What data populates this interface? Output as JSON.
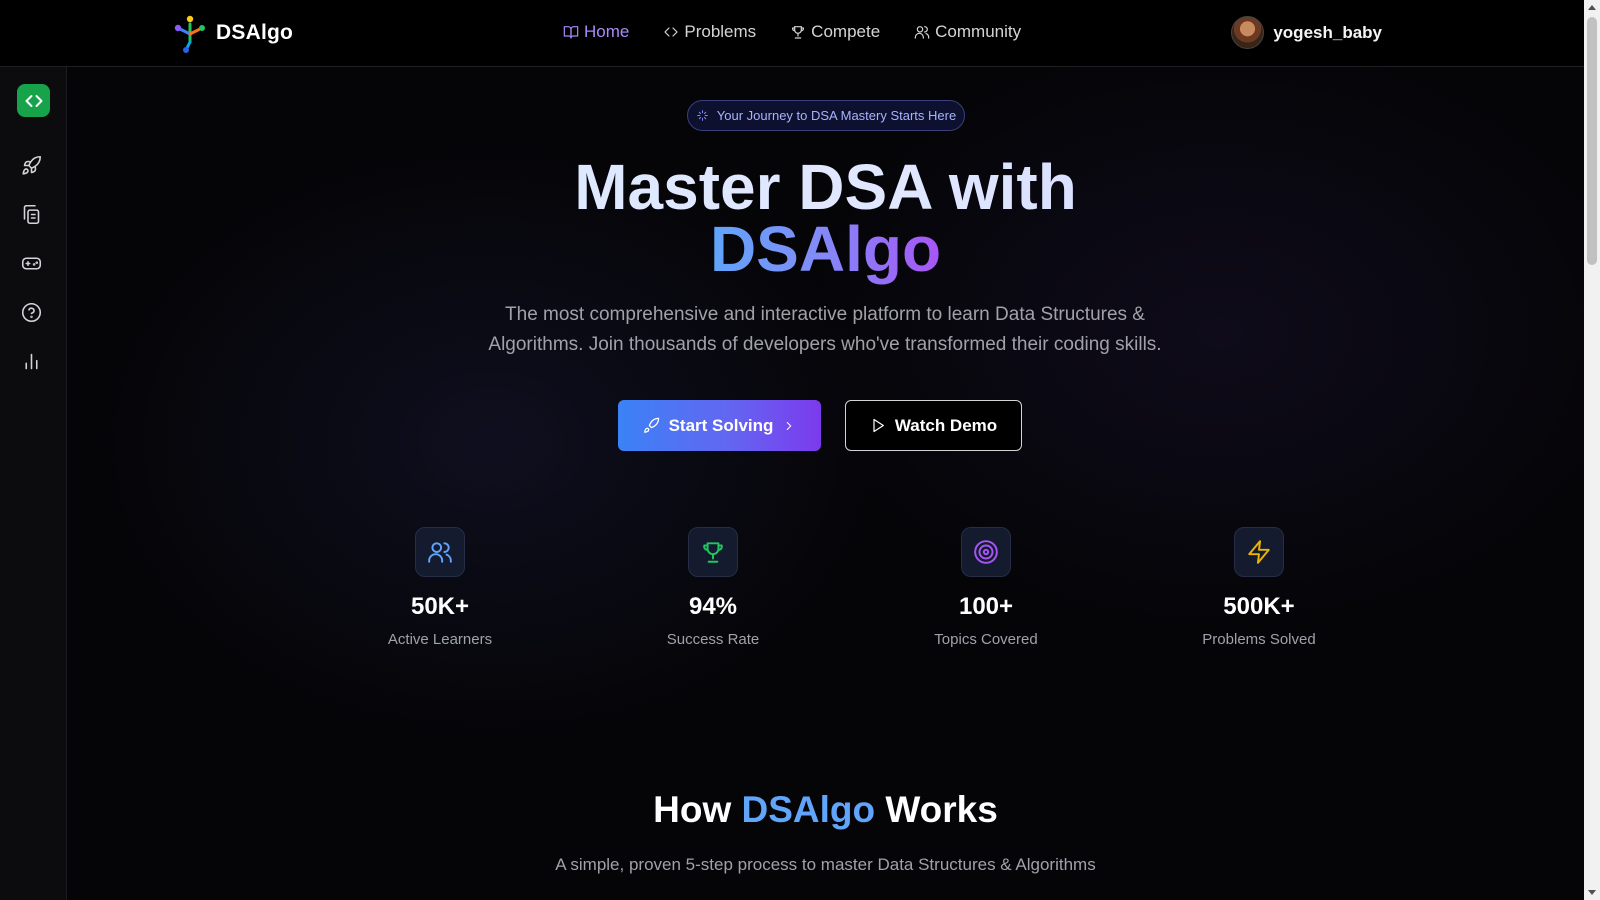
{
  "app": {
    "name": "DSAlgo"
  },
  "nav": {
    "items": [
      {
        "label": "Home",
        "icon": "book-open-icon",
        "active": true
      },
      {
        "label": "Problems",
        "icon": "code-icon",
        "active": false
      },
      {
        "label": "Compete",
        "icon": "trophy-icon",
        "active": false
      },
      {
        "label": "Community",
        "icon": "users-icon",
        "active": false
      }
    ]
  },
  "user": {
    "name": "yogesh_baby"
  },
  "sidebar": {
    "items": [
      "code-brackets-icon",
      "rocket-icon",
      "copy-icon",
      "gamepad-icon",
      "help-circle-icon",
      "bar-chart-icon"
    ]
  },
  "hero": {
    "badge": "Your Journey to DSA Mastery Starts Here",
    "title_line1": "Master DSA with",
    "title_line2": "DSAlgo",
    "subtitle": "The most comprehensive and interactive platform to learn Data Structures & Algorithms. Join thousands of developers who've transformed their coding skills.",
    "primary_button": "Start Solving",
    "secondary_button": "Watch Demo"
  },
  "stats": [
    {
      "value": "50K+",
      "label": "Active Learners",
      "icon": "users-icon",
      "color": "#60a5fa"
    },
    {
      "value": "94%",
      "label": "Success Rate",
      "icon": "trophy-icon",
      "color": "#22c55e"
    },
    {
      "value": "100+",
      "label": "Topics Covered",
      "icon": "target-icon",
      "color": "#a855f7"
    },
    {
      "value": "500K+",
      "label": "Problems Solved",
      "icon": "zap-icon",
      "color": "#eab308"
    }
  ],
  "how": {
    "title_prefix": "How",
    "title_accent": "DSAlgo",
    "title_suffix": "Works",
    "subtitle": "A simple, proven 5-step process to master Data Structures & Algorithms"
  },
  "colors": {
    "accent": "#a78bfa",
    "sidebar_logo": "#16a34a",
    "primary_gradient": [
      "#3b82f6",
      "#7c3aed"
    ]
  }
}
